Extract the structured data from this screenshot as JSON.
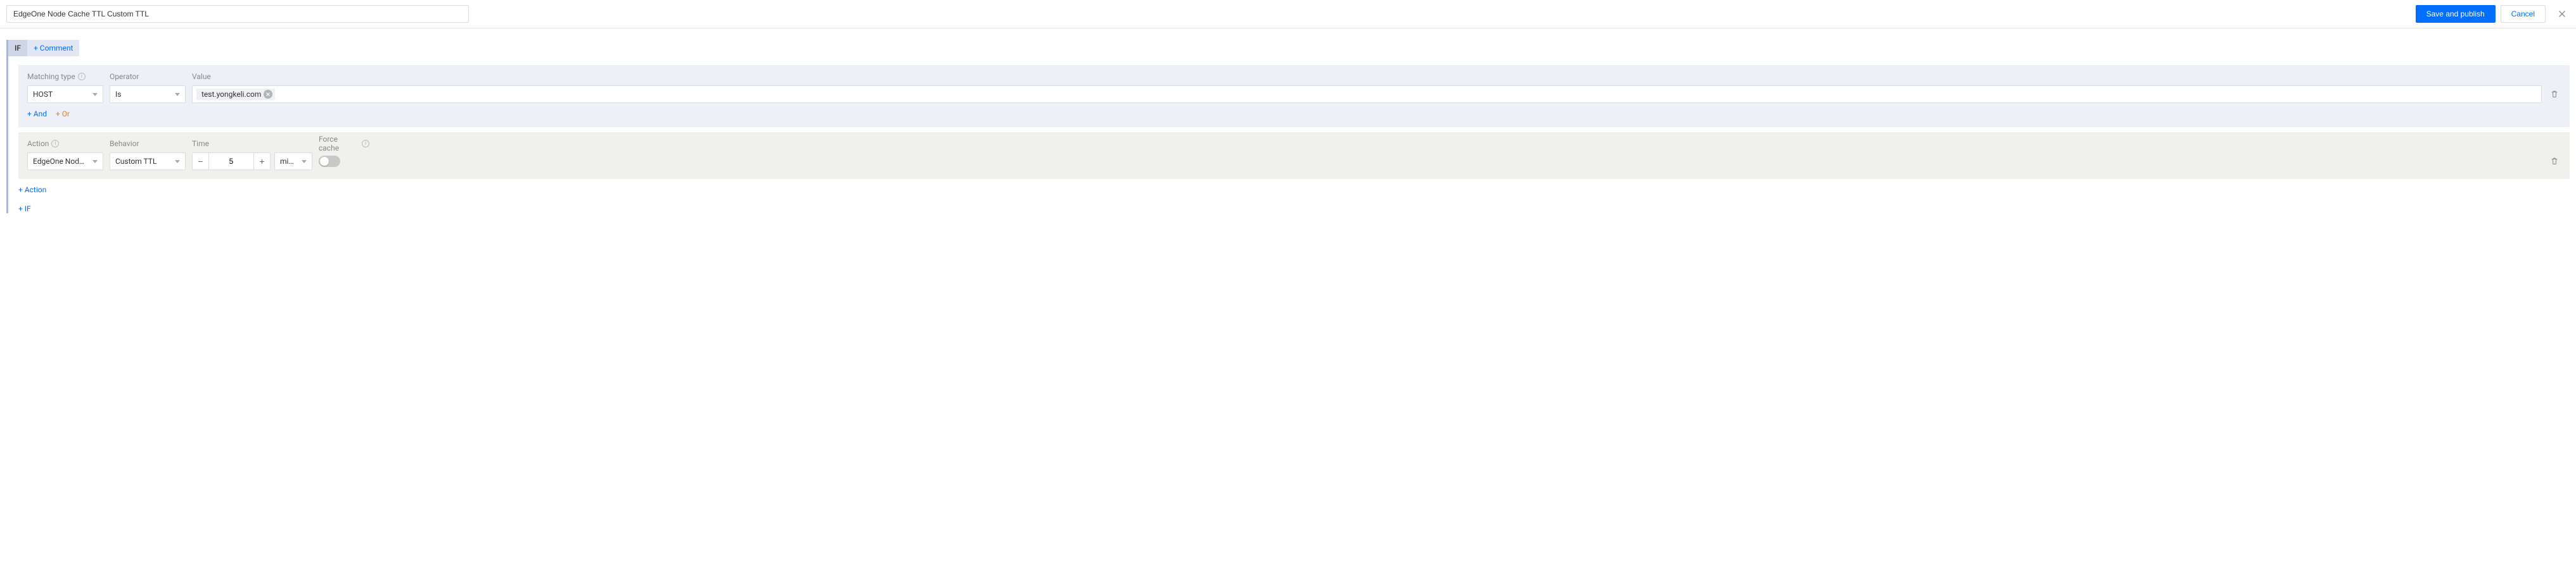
{
  "header": {
    "rule_name": "EdgeOne Node Cache TTL Custom TTL",
    "save_label": "Save and publish",
    "cancel_label": "Cancel"
  },
  "rule": {
    "if_label": "IF",
    "comment_label": "+  Comment"
  },
  "condition": {
    "labels": {
      "matching_type": "Matching type",
      "operator": "Operator",
      "value": "Value"
    },
    "matching_value": "HOST",
    "operator_value": "Is",
    "host_tag": "test.yongkeli.com",
    "add_and": "+  And",
    "add_or": "+  Or"
  },
  "action": {
    "labels": {
      "action": "Action",
      "behavior": "Behavior",
      "time": "Time",
      "force_cache": "Force cache"
    },
    "action_value": "EdgeOne Node Cache …",
    "behavior_value": "Custom TTL",
    "time_value": "5",
    "time_unit": "minutes"
  },
  "footer": {
    "add_action": "+  Action",
    "add_if": "+  IF"
  }
}
